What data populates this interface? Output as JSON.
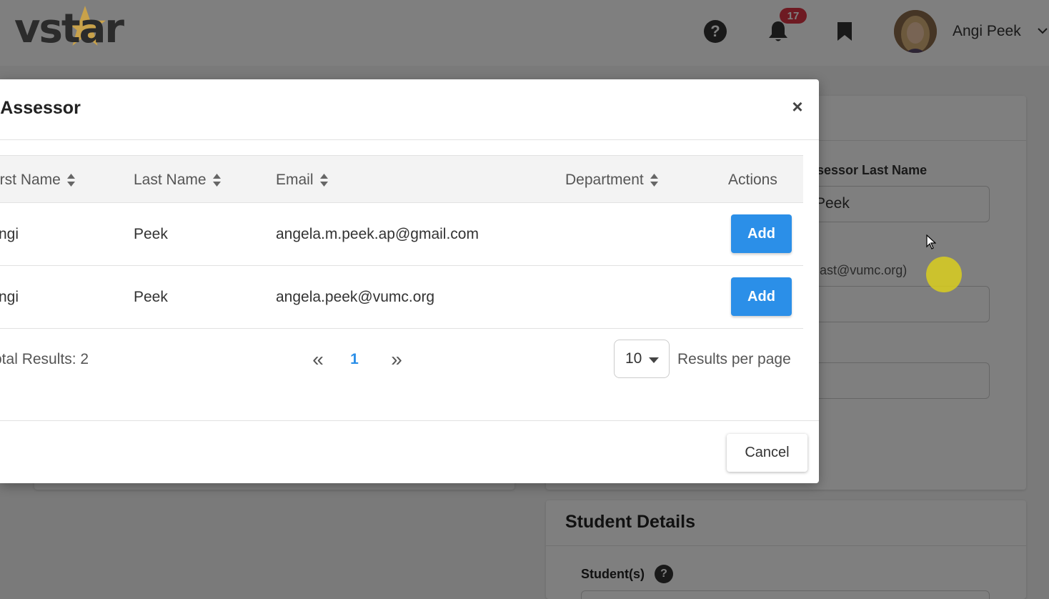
{
  "brand": {
    "logo_text": "vstar",
    "accent_star_color": "#c9a24a"
  },
  "header": {
    "notification_count": "17",
    "user_name": "Angi Peek",
    "icons": [
      "help-icon",
      "bell-icon",
      "bookmark-icon",
      "avatar",
      "chevron-down-icon"
    ]
  },
  "background": {
    "assessor_last_name_label": "sessor Last Name",
    "assessor_last_name_value": "Peek",
    "email_hint": "ast@vumc.org)",
    "student_details_title": "Student Details",
    "students_label": "Student(s)"
  },
  "modal": {
    "title": "ld Assessor",
    "close_symbol": "×",
    "columns": {
      "first_name": "irst Name",
      "last_name": "Last Name",
      "email": "Email",
      "department": "Department",
      "actions": "Actions"
    },
    "rows": [
      {
        "first_name": "ngi",
        "last_name": "Peek",
        "email": "angela.m.peek.ap@gmail.com",
        "department": "",
        "action_label": "Add"
      },
      {
        "first_name": "ngi",
        "last_name": "Peek",
        "email": "angela.peek@vumc.org",
        "department": "",
        "action_label": "Add"
      }
    ],
    "pagination": {
      "total_results": "otal Results: 2",
      "first_symbol": "«",
      "current_page": "1",
      "last_symbol": "»",
      "per_page_value": "10",
      "per_page_label": "Results per page"
    },
    "cancel_label": "Cancel"
  },
  "colors": {
    "primary": "#2b8fe8",
    "badge": "#dc3545",
    "backdrop": "rgba(0,0,0,0.5)",
    "click_indicator": "#d9ce1e"
  }
}
